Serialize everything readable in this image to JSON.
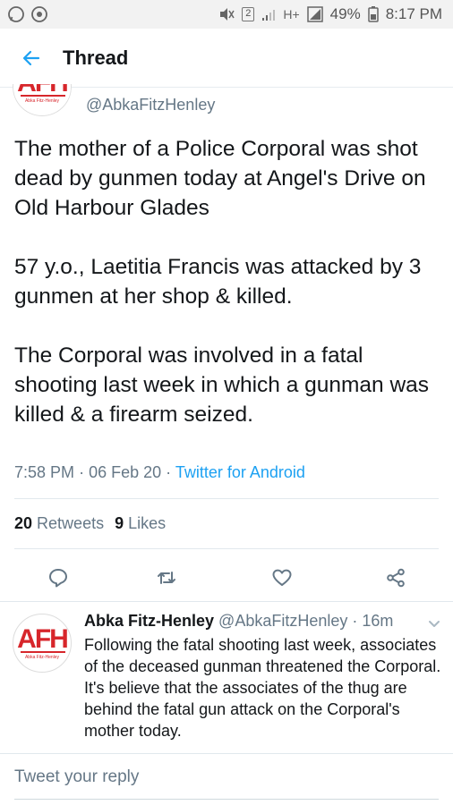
{
  "status_bar": {
    "battery": "49%",
    "sim": "2",
    "network": "H+",
    "time": "8:17 PM"
  },
  "header": {
    "title": "Thread"
  },
  "main_tweet": {
    "author_handle": "@AbkaFitzHenley",
    "avatar_logo": "AFH",
    "avatar_sub": "Abka Fitz-Henley",
    "paragraphs": [
      "The mother of a Police Corporal was shot dead by gunmen today at Angel's Drive on Old Harbour Glades",
      "57 y.o., Laetitia Francis was attacked by 3 gunmen at her shop & killed.",
      "The Corporal was involved in a fatal shooting last week in which a gunman was killed & a firearm seized."
    ],
    "time": "7:58 PM",
    "date": "06 Feb 20",
    "separator": "·",
    "source": "Twitter for Android",
    "retweets_count": "20",
    "retweets_label": "Retweets",
    "likes_count": "9",
    "likes_label": "Likes"
  },
  "reply": {
    "name": "Abka Fitz-Henley",
    "handle": "@AbkaFitzHenley",
    "time_ago": "· 16m",
    "text": "Following the fatal shooting last week, associates of the deceased gunman threatened the Corporal. It's believe that the associates of the thug are behind the fatal gun attack on the Corporal's mother today."
  },
  "compose": {
    "placeholder": "Tweet your reply"
  },
  "colors": {
    "accent": "#1da1f2",
    "secondary_text": "#657786",
    "logo_red": "#d7262b"
  },
  "icons": {
    "back": "arrow-left-icon",
    "reply": "reply-icon",
    "retweet": "retweet-icon",
    "like": "heart-icon",
    "share": "share-icon",
    "caret": "chevron-down-icon"
  }
}
